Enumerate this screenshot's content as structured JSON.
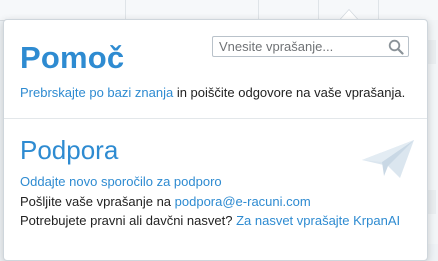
{
  "help": {
    "title": "Pomoč",
    "search_placeholder": "Vnesite vprašanje...",
    "search_value": "",
    "intro_link": "Prebrskajte po bazi znanja",
    "intro_text": " in poiščite odgovore na vaše vprašanja."
  },
  "support": {
    "title": "Podpora",
    "new_report_link": "Oddajte novo sporočilo za podporo",
    "email_prefix": "Pošljite vaše vprašanje na ",
    "email_link": "podpora@e-racuni.com",
    "legal_text": "Potrebujete pravni ali davčni nasvet? ",
    "legal_link": "Za nasvet vprašajte KrpanAI"
  },
  "icons": {
    "search": "search-icon",
    "plane": "paper-plane-icon"
  },
  "colors": {
    "accent": "#2e8bd1",
    "text": "#222222",
    "plane": "#dbe6ef"
  }
}
